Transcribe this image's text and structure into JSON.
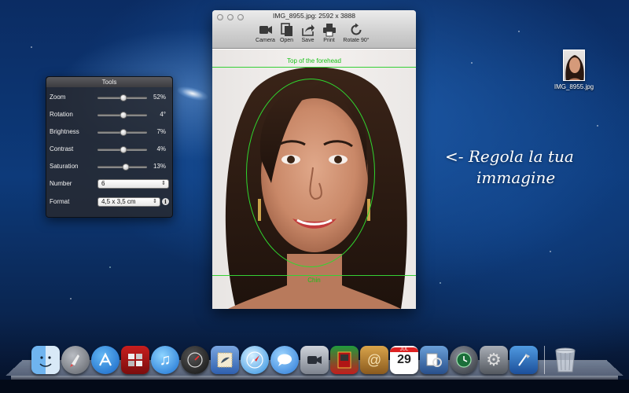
{
  "tools_panel": {
    "title": "Tools",
    "sliders": [
      {
        "id": "zoom",
        "label": "Zoom",
        "value": "52%",
        "level": 0.52
      },
      {
        "id": "rotation",
        "label": "Rotation",
        "value": "4°",
        "level": 0.52
      },
      {
        "id": "brightness",
        "label": "Brightness",
        "value": "7%",
        "level": 0.53
      },
      {
        "id": "contrast",
        "label": "Contrast",
        "value": "4%",
        "level": 0.52
      },
      {
        "id": "saturation",
        "label": "Saturation",
        "value": "13%",
        "level": 0.57
      }
    ],
    "number": {
      "label": "Number",
      "value": "6"
    },
    "format": {
      "label": "Format",
      "value": "4,5 x 3,5 cm",
      "info": "i"
    }
  },
  "image_window": {
    "title": "IMG_8955.jpg: 2592 x 3888",
    "toolbar": [
      {
        "id": "camera",
        "label": "Camera",
        "icon": "camera-icon"
      },
      {
        "id": "open",
        "label": "Open",
        "icon": "open-icon"
      },
      {
        "id": "save",
        "label": "Save",
        "icon": "save-icon"
      },
      {
        "id": "print",
        "label": "Print",
        "icon": "print-icon"
      },
      {
        "id": "rotate",
        "label": "Rotate 90°",
        "icon": "rotate-icon"
      }
    ],
    "guides": {
      "top": "Top of the forehead",
      "bottom": "Chin"
    }
  },
  "desktop_icon": {
    "label": "IMG_8955.jpg"
  },
  "hint": {
    "line1": "<- Regola la tua",
    "line2": "immagine"
  },
  "dock": {
    "items": [
      "finder",
      "launchpad",
      "app-store",
      "photo-booth",
      "itunes",
      "dashboard",
      "mail-stamp",
      "safari",
      "messages",
      "facetime",
      "photo-booth-red",
      "contacts",
      "calendar",
      "preview",
      "time-machine",
      "system-preferences",
      "xcode",
      "trash"
    ],
    "calendar_day": "29",
    "calendar_month": "JUL",
    "colors": {
      "accent": "#35d035"
    }
  }
}
